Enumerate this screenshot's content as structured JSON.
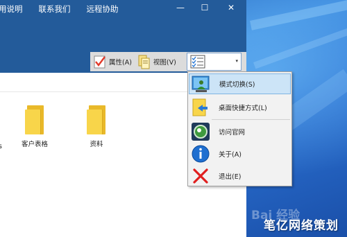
{
  "window": {
    "menu": [
      "用说明",
      "联系我们",
      "远程协助"
    ],
    "controls": {
      "minimize": "—",
      "maximize": "☐",
      "close": "✕"
    }
  },
  "toolbar": {
    "properties_label": "属性(A)",
    "view_label": "视图(V)",
    "dropdown_arrow": "▾"
  },
  "files": [
    {
      "name": "客户表格"
    },
    {
      "name": "资料"
    }
  ],
  "partial_label": "s",
  "context_menu": {
    "items": [
      {
        "label": "模式切换(S)",
        "icon": "mode-switch-icon",
        "selected": true
      },
      {
        "label": "桌面快捷方式(L)",
        "icon": "shortcut-icon",
        "selected": false
      },
      {
        "label": "访问官网",
        "icon": "website-icon",
        "selected": false
      },
      {
        "label": "关于(A)",
        "icon": "info-icon",
        "selected": false
      },
      {
        "label": "退出(E)",
        "icon": "exit-icon",
        "selected": false
      }
    ]
  },
  "watermark": {
    "text": "笔亿网络策划",
    "faint": "Bai 经验"
  },
  "colors": {
    "titlebar": "#235b9a",
    "selection": "#cce4f7",
    "folder": "#f8d54a"
  }
}
